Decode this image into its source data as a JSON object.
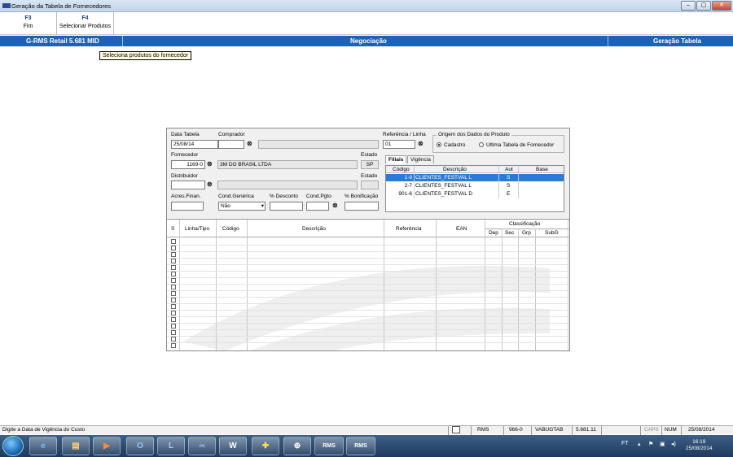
{
  "window": {
    "title": "Geração da Tabela de Fornecedores",
    "min": "–",
    "max": "▢",
    "close": "✕"
  },
  "fkeys": [
    {
      "key": "F3",
      "label": "Fim"
    },
    {
      "key": "F4",
      "label": "Selecionar Produtos"
    }
  ],
  "header": {
    "product": "G-RMS Retail 5.681 MID",
    "section": "Negociação",
    "screen": "Geração Tabela"
  },
  "tooltip": "Seleciona produtos do fornecedor",
  "form": {
    "data_tabela_label": "Data Tabela",
    "data_tabela": "25/08/14",
    "comprador_label": "Comprador",
    "comprador": "",
    "comprador_nome": "",
    "referencia_label": "Referência / Linha",
    "referencia": "01",
    "fornecedor_label": "Fornecedor",
    "fornecedor": "1169-0",
    "fornecedor_nome": "3M DO BRASIL LTDA",
    "estado_label": "Estado",
    "estado": "SP",
    "distribuidor_label": "Distribuidor",
    "distribuidor": "",
    "distribuidor_nome": "",
    "estado2_label": "Estado",
    "estado2": "",
    "acres_label": "Acres.Finan.",
    "acres": "",
    "cond_gen_label": "Cond.Genérica",
    "cond_gen": "Não",
    "desconto_label": "% Desconto",
    "desconto": "",
    "cond_pgto_label": "Cond.Pgto",
    "cond_pgto": "",
    "bonif_label": "% Bonificação",
    "bonif": "",
    "origem_label": "Origem dos Dados do Produto",
    "origem_opt1": "Cadastro",
    "origem_opt2": "Ultima Tabela de Fornecedor"
  },
  "tabs": [
    "Filiais",
    "Vigência"
  ],
  "filiais": {
    "headers": [
      "Código",
      "Descrição",
      "Aut",
      "Base"
    ],
    "rows": [
      {
        "cod": "1-9",
        "desc": "CLIENTES_FESTVAL L",
        "aut": "S",
        "base": ""
      },
      {
        "cod": "2-7",
        "desc": "CLIENTES_FESTVAL L",
        "aut": "S",
        "base": ""
      },
      {
        "cod": "901-6",
        "desc": "CLIENTES_FESTVAL D",
        "aut": "E",
        "base": ""
      }
    ]
  },
  "grid": {
    "s": "S",
    "linha": "Linha/Tipo",
    "codigo": "Código",
    "descricao": "Descrição",
    "referencia": "Referência",
    "ean": "EAN",
    "classificacao": "Classificação",
    "dep": "Dep",
    "sec": "Sec",
    "grp": "Grp",
    "subg": "SubG"
  },
  "status": {
    "hint": "Digite a Data de Vigência do Custo",
    "app": "RMS",
    "code": "966-0",
    "program": "VABUGTAB",
    "version": "5.681.11",
    "caps": "CAPS",
    "num": "NUM",
    "date": "25/08/2014"
  },
  "taskbar": {
    "lang": "FT",
    "time": "16:19",
    "date": "25/08/2014",
    "apps": [
      "e",
      "▤",
      "▶",
      "O",
      "L",
      "∞",
      "W",
      "✚",
      "⊕",
      "RMS",
      "RMS"
    ]
  }
}
